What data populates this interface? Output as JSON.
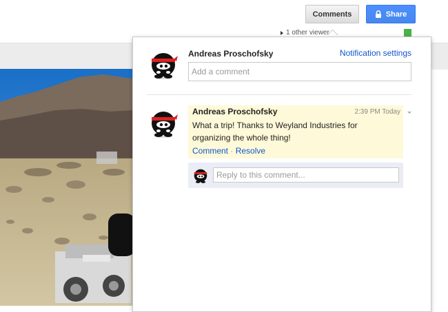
{
  "header": {
    "comments_label": "Comments",
    "share_label": "Share",
    "viewers_text": "1 other viewer",
    "accent_blue": "#4d90fe",
    "viewer_color": "#4db147"
  },
  "panel": {
    "current_user": "Andreas Proschofsky",
    "notification_settings": "Notification settings",
    "add_comment_placeholder": "Add a comment",
    "comment": {
      "author": "Andreas Proschofsky",
      "time": "2:39 PM Today",
      "text": "What a trip! Thanks to Weyland Industries for organizing the whole thing!",
      "comment_link": "Comment",
      "separator": "·",
      "resolve_link": "Resolve",
      "highlight_color": "#fef9d8"
    },
    "reply_placeholder": "Reply to this comment..."
  }
}
